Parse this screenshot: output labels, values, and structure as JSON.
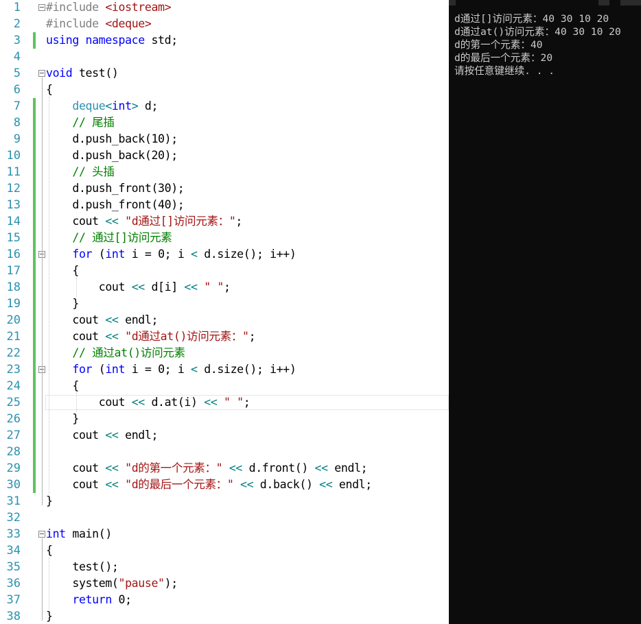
{
  "editor": {
    "line_numbers": [
      "1",
      "2",
      "3",
      "4",
      "5",
      "6",
      "7",
      "8",
      "9",
      "10",
      "11",
      "12",
      "13",
      "14",
      "15",
      "16",
      "17",
      "18",
      "19",
      "20",
      "21",
      "22",
      "23",
      "24",
      "25",
      "26",
      "27",
      "28",
      "29",
      "30",
      "31",
      "32",
      "33",
      "34",
      "35",
      "36",
      "37",
      "38"
    ],
    "lines": [
      [
        [
          "pp",
          "#include "
        ],
        [
          "inc",
          "<iostream>"
        ]
      ],
      [
        [
          "pp",
          "#include "
        ],
        [
          "inc",
          "<deque>"
        ]
      ],
      [
        [
          "kw",
          "using"
        ],
        [
          "p",
          " "
        ],
        [
          "kw",
          "namespace"
        ],
        [
          "p",
          " std;"
        ]
      ],
      [],
      [
        [
          "kw",
          "void"
        ],
        [
          "p",
          " test()"
        ]
      ],
      [
        [
          "p",
          "{"
        ]
      ],
      [
        [
          "p",
          "    "
        ],
        [
          "ty",
          "deque"
        ],
        [
          "op",
          "<"
        ],
        [
          "kw",
          "int"
        ],
        [
          "op",
          ">"
        ],
        [
          "p",
          " d;"
        ]
      ],
      [
        [
          "p",
          "    "
        ],
        [
          "cm",
          "// 尾插"
        ]
      ],
      [
        [
          "p",
          "    d.push_back(10);"
        ]
      ],
      [
        [
          "p",
          "    d.push_back(20);"
        ]
      ],
      [
        [
          "p",
          "    "
        ],
        [
          "cm",
          "// 头插"
        ]
      ],
      [
        [
          "p",
          "    d.push_front(30);"
        ]
      ],
      [
        [
          "p",
          "    d.push_front(40);"
        ]
      ],
      [
        [
          "p",
          "    cout "
        ],
        [
          "op",
          "<<"
        ],
        [
          "p",
          " "
        ],
        [
          "str",
          "\"d通过[]访问元素：\""
        ],
        [
          "p",
          ";"
        ]
      ],
      [
        [
          "p",
          "    "
        ],
        [
          "cm",
          "// 通过[]访问元素"
        ]
      ],
      [
        [
          "p",
          "    "
        ],
        [
          "kw",
          "for"
        ],
        [
          "p",
          " ("
        ],
        [
          "kw",
          "int"
        ],
        [
          "p",
          " i = 0; i "
        ],
        [
          "op",
          "<"
        ],
        [
          "p",
          " d.size(); i++)"
        ]
      ],
      [
        [
          "p",
          "    {"
        ]
      ],
      [
        [
          "p",
          "        cout "
        ],
        [
          "op",
          "<<"
        ],
        [
          "p",
          " d[i] "
        ],
        [
          "op",
          "<<"
        ],
        [
          "p",
          " "
        ],
        [
          "str",
          "\" \""
        ],
        [
          "p",
          ";"
        ]
      ],
      [
        [
          "p",
          "    }"
        ]
      ],
      [
        [
          "p",
          "    cout "
        ],
        [
          "op",
          "<<"
        ],
        [
          "p",
          " endl;"
        ]
      ],
      [
        [
          "p",
          "    cout "
        ],
        [
          "op",
          "<<"
        ],
        [
          "p",
          " "
        ],
        [
          "str",
          "\"d通过at()访问元素：\""
        ],
        [
          "p",
          ";"
        ]
      ],
      [
        [
          "p",
          "    "
        ],
        [
          "cm",
          "// 通过at()访问元素"
        ]
      ],
      [
        [
          "p",
          "    "
        ],
        [
          "kw",
          "for"
        ],
        [
          "p",
          " ("
        ],
        [
          "kw",
          "int"
        ],
        [
          "p",
          " i = 0; i "
        ],
        [
          "op",
          "<"
        ],
        [
          "p",
          " d.size(); i++)"
        ]
      ],
      [
        [
          "p",
          "    {"
        ]
      ],
      [
        [
          "p",
          "        cout "
        ],
        [
          "op",
          "<<"
        ],
        [
          "p",
          " d.at(i) "
        ],
        [
          "op",
          "<<"
        ],
        [
          "p",
          " "
        ],
        [
          "str",
          "\" \""
        ],
        [
          "p",
          ";"
        ]
      ],
      [
        [
          "p",
          "    }"
        ]
      ],
      [
        [
          "p",
          "    cout "
        ],
        [
          "op",
          "<<"
        ],
        [
          "p",
          " endl;"
        ]
      ],
      [],
      [
        [
          "p",
          "    cout "
        ],
        [
          "op",
          "<<"
        ],
        [
          "p",
          " "
        ],
        [
          "str",
          "\"d的第一个元素：\""
        ],
        [
          "p",
          " "
        ],
        [
          "op",
          "<<"
        ],
        [
          "p",
          " d.front() "
        ],
        [
          "op",
          "<<"
        ],
        [
          "p",
          " endl;"
        ]
      ],
      [
        [
          "p",
          "    cout "
        ],
        [
          "op",
          "<<"
        ],
        [
          "p",
          " "
        ],
        [
          "str",
          "\"d的最后一个元素：\""
        ],
        [
          "p",
          " "
        ],
        [
          "op",
          "<<"
        ],
        [
          "p",
          " d.back() "
        ],
        [
          "op",
          "<<"
        ],
        [
          "p",
          " endl;"
        ]
      ],
      [
        [
          "p",
          "}"
        ]
      ],
      [],
      [
        [
          "kw",
          "int"
        ],
        [
          "p",
          " main()"
        ]
      ],
      [
        [
          "p",
          "{"
        ]
      ],
      [
        [
          "p",
          "    test();"
        ]
      ],
      [
        [
          "p",
          "    system("
        ],
        [
          "str",
          "\"pause\""
        ],
        [
          "p",
          ");"
        ]
      ],
      [
        [
          "p",
          "    "
        ],
        [
          "kw",
          "return"
        ],
        [
          "p",
          " 0;"
        ]
      ],
      [
        [
          "p",
          "}"
        ]
      ]
    ],
    "current_line": 25
  },
  "console": {
    "lines": [
      "d通过[]访问元素：40 30 10 20",
      "d通过at()访问元素：40 30 10 20",
      "d的第一个元素：40",
      "d的最后一个元素：20",
      "请按任意键继续. . ."
    ]
  },
  "colors": {
    "keyword": "#0000ff",
    "preprocessor": "#808080",
    "string": "#a31515",
    "comment": "#008000",
    "type": "#2b91af",
    "operator": "#008080",
    "line_number": "#2b91af",
    "change_bar": "#5ec45e",
    "console_bg": "#0c0c0c",
    "console_text": "#cccccc"
  }
}
